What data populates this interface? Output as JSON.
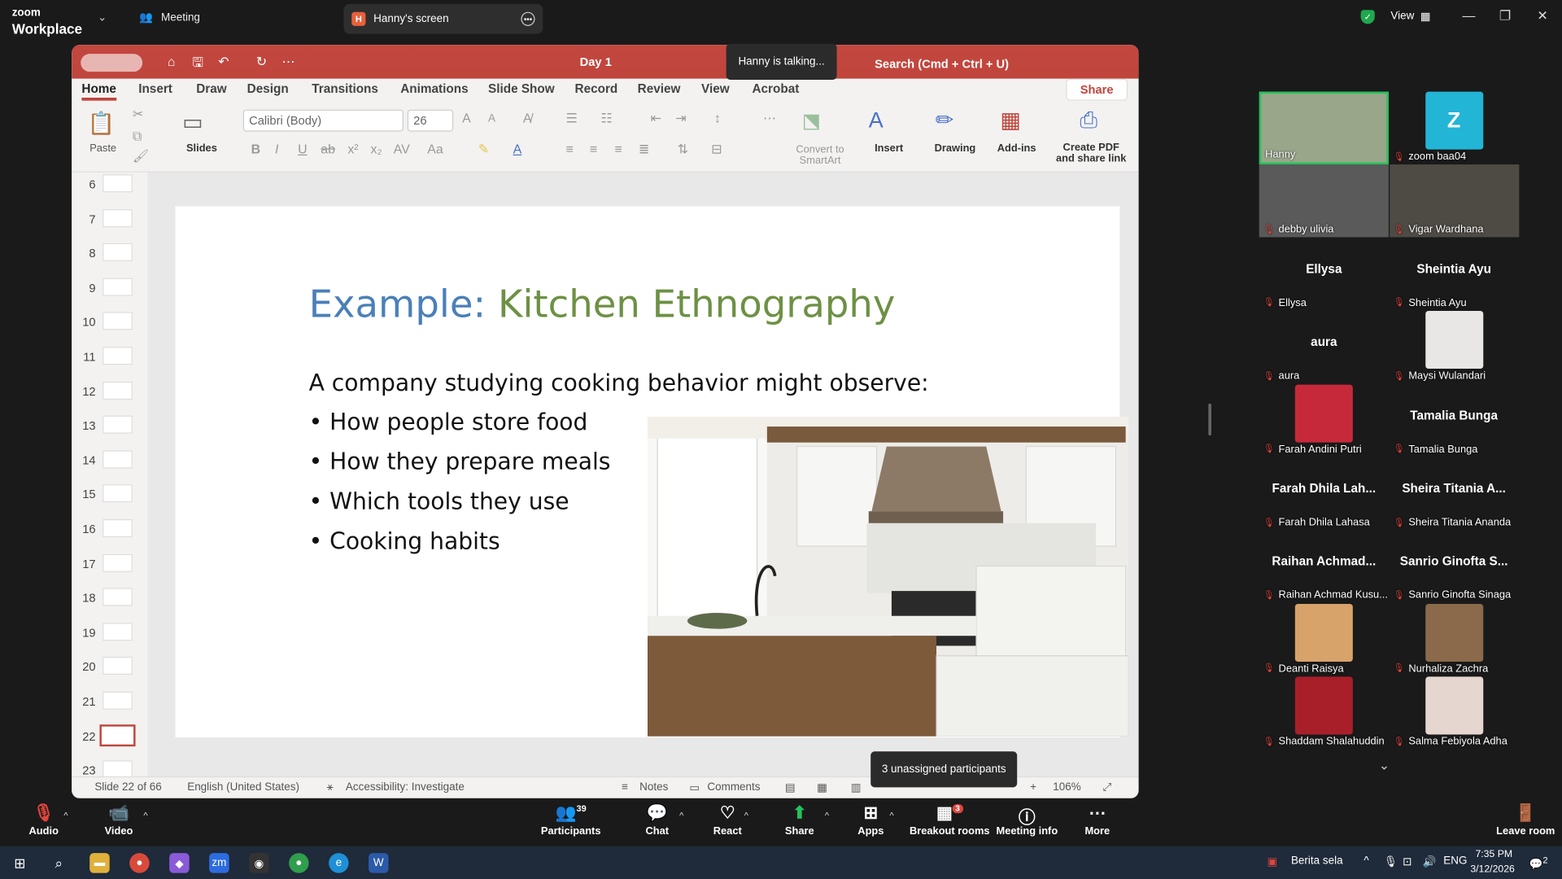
{
  "app": {
    "brand_top": "zoom",
    "brand_bottom": "Workplace",
    "meeting_tab": "Meeting",
    "screen_tab": "Hanny's screen",
    "screen_badge": "H",
    "view_label": "View"
  },
  "ppt": {
    "doc_title": "Day 1",
    "search": "Search (Cmd + Ctrl + U)",
    "talking": "Hanny is talking...",
    "tabs": [
      "Home",
      "Insert",
      "Draw",
      "Design",
      "Transitions",
      "Animations",
      "Slide Show",
      "Record",
      "Review",
      "View",
      "Acrobat"
    ],
    "share": "Share",
    "ribbon": {
      "paste": "Paste",
      "slides": "Slides",
      "font": "Calibri (Body)",
      "size": "26",
      "convert": "Convert to\nSmartArt",
      "insert": "Insert",
      "drawing": "Drawing",
      "addins": "Add-ins",
      "createpdf": "Create PDF\nand share link"
    },
    "thumbnails": [
      "6",
      "7",
      "8",
      "9",
      "10",
      "11",
      "12",
      "13",
      "14",
      "15",
      "16",
      "17",
      "18",
      "19",
      "20",
      "21",
      "22",
      "23"
    ],
    "selected_slide": "22",
    "slide": {
      "title_a": "Example: ",
      "title_b": "Kitchen Ethnography",
      "intro": "A company studying cooking behavior might observe:",
      "bullets": [
        "• How people store food",
        "• How they prepare meals",
        "• Which tools they use",
        "• Cooking habits"
      ]
    },
    "status": {
      "slide": "Slide 22 of 66",
      "lang": "English (United States)",
      "access": "Accessibility: Investigate",
      "notes": "Notes",
      "comments": "Comments",
      "zoom": "106%"
    }
  },
  "unassigned": "3 unassigned participants",
  "participants": [
    {
      "label": "Hanny",
      "big": ""
    },
    {
      "label": "zoom baa04",
      "big": "Z"
    },
    {
      "label": "debby ulivia",
      "big": ""
    },
    {
      "label": "Vigar Wardhana",
      "big": ""
    },
    {
      "label": "Ellysa",
      "big": "Ellysa"
    },
    {
      "label": "Sheintia Ayu",
      "big": "Sheintia Ayu"
    },
    {
      "label": "aura",
      "big": "aura"
    },
    {
      "label": "Maysi Wulandari",
      "big": ""
    },
    {
      "label": "Farah Andini Putri",
      "big": ""
    },
    {
      "label": "Tamalia Bunga",
      "big": "Tamalia Bunga"
    },
    {
      "label": "Farah Dhila Lahasa",
      "big": "Farah Dhila Lah..."
    },
    {
      "label": "Sheira Titania Ananda",
      "big": "Sheira Titania A..."
    },
    {
      "label": "Raihan Achmad Kusu...",
      "big": "Raihan Achmad..."
    },
    {
      "label": "Sanrio Ginofta Sinaga",
      "big": "Sanrio Ginofta S..."
    },
    {
      "label": "Deanti Raisya",
      "big": ""
    },
    {
      "label": "Nurhaliza Zachra",
      "big": ""
    },
    {
      "label": "Shaddam Shalahuddin",
      "big": ""
    },
    {
      "label": "Salma Febiyola Adha",
      "big": ""
    }
  ],
  "toolbar": {
    "audio": "Audio",
    "video": "Video",
    "participants": "Participants",
    "participants_count": "39",
    "chat": "Chat",
    "react": "React",
    "share": "Share",
    "apps": "Apps",
    "breakout": "Breakout rooms",
    "breakout_badge": "3",
    "info": "Meeting info",
    "more": "More",
    "leave": "Leave room"
  },
  "taskbar": {
    "news": "Berita sela",
    "lang": "ENG",
    "time": "7:35 PM",
    "date": "3/12/2026",
    "notif": "2"
  }
}
